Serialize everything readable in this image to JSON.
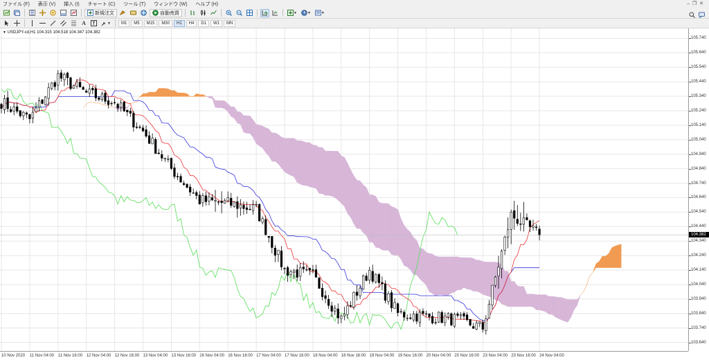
{
  "menu": [
    {
      "label": "ファイル (F)"
    },
    {
      "label": "表示 (V)"
    },
    {
      "label": "挿入 (I)"
    },
    {
      "label": "チャート (C)"
    },
    {
      "label": "ツール (T)"
    },
    {
      "label": "ウィンドウ (W)"
    },
    {
      "label": "ヘルプ (H)"
    }
  ],
  "toolbar": {
    "new_order": "新規注文",
    "auto_trading": "自動売買"
  },
  "timeframes": [
    "M1",
    "M5",
    "M15",
    "M30",
    "H1",
    "H4",
    "D1",
    "W1",
    "MN"
  ],
  "chart": {
    "symbol_info": "USDJPY-cd,H1  104.315 104.518 104.347 104.382",
    "current_price": "104.382",
    "price_labels": [
      "105.740",
      "105.640",
      "105.540",
      "105.440",
      "105.340",
      "105.240",
      "105.140",
      "105.040",
      "104.940",
      "104.840",
      "104.740",
      "104.640",
      "104.540",
      "104.440",
      "104.340",
      "104.240",
      "104.140",
      "104.040",
      "103.940",
      "103.840",
      "103.740",
      "103.640"
    ],
    "time_labels": [
      "10 Nov 2020",
      "11 Nov 04:00",
      "11 Nov 16:00",
      "12 Nov 04:00",
      "12 Nov 16:00",
      "13 Nov 04:00",
      "13 Nov 16:00",
      "16 Nov 04:00",
      "16 Nov 16:00",
      "17 Nov 04:00",
      "17 Nov 16:00",
      "18 Nov 04:00",
      "18 Nov 16:00",
      "19 Nov 04:00",
      "19 Nov 16:00",
      "20 Nov 04:00",
      "20 Nov 16:00",
      "23 Nov 04:00",
      "23 Nov 16:00",
      "24 Nov 04:00"
    ],
    "colors": {
      "kumo_bull": "#f09a52",
      "kumo_bear": "#d7b6d8",
      "tenkan": "#ee3333",
      "kijun": "#3333dd",
      "chikou": "#55dd55",
      "candle": "#000000"
    }
  },
  "chart_data": {
    "type": "candlestick",
    "symbol": "USDJPY-cd",
    "timeframe": "H1",
    "ylim": [
      103.6,
      105.78
    ],
    "x": [
      "10 Nov 2020",
      "11 Nov 04:00",
      "11 Nov 16:00",
      "12 Nov 04:00",
      "12 Nov 16:00",
      "13 Nov 04:00",
      "13 Nov 16:00",
      "16 Nov 04:00",
      "16 Nov 16:00",
      "17 Nov 04:00",
      "17 Nov 16:00",
      "18 Nov 04:00",
      "18 Nov 16:00",
      "19 Nov 04:00",
      "19 Nov 16:00",
      "20 Nov 04:00",
      "20 Nov 16:00",
      "23 Nov 04:00",
      "23 Nov 16:00",
      "24 Nov 04:00"
    ],
    "close": [
      105.3,
      105.18,
      105.48,
      105.36,
      105.3,
      105.1,
      104.84,
      104.62,
      104.6,
      104.56,
      104.14,
      104.1,
      103.8,
      104.14,
      103.84,
      103.82,
      103.8,
      103.74,
      104.52,
      104.38
    ],
    "high": [
      105.46,
      105.36,
      105.7,
      105.48,
      105.42,
      105.16,
      104.96,
      104.74,
      105.14,
      104.7,
      104.5,
      104.24,
      104.1,
      104.22,
      104.0,
      103.92,
      103.9,
      103.82,
      104.64,
      104.66
    ],
    "low": [
      105.04,
      105.02,
      105.24,
      105.2,
      105.16,
      104.86,
      104.7,
      104.46,
      104.5,
      104.34,
      104.06,
      103.9,
      103.66,
      103.76,
      103.78,
      103.74,
      103.72,
      103.68,
      103.72,
      104.3
    ]
  }
}
